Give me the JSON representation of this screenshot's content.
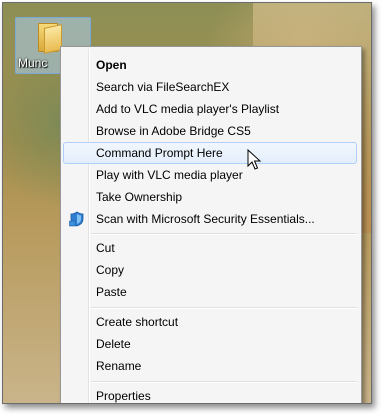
{
  "desktop": {
    "icon": {
      "name": "folder-icon",
      "label": "Munc"
    }
  },
  "menu": {
    "hovered_item": "Command Prompt Here",
    "groups": [
      [
        {
          "label": "Open",
          "bold": true
        },
        {
          "label": "Search via FileSearchEX"
        },
        {
          "label": "Add to VLC media player's Playlist"
        },
        {
          "label": "Browse in Adobe Bridge CS5"
        },
        {
          "label": "Command Prompt Here"
        },
        {
          "label": "Play with VLC media player"
        },
        {
          "label": "Take Ownership"
        },
        {
          "label": "Scan with Microsoft Security Essentials...",
          "icon": "microsoft-security-essentials-icon"
        }
      ],
      [
        {
          "label": "Cut"
        },
        {
          "label": "Copy"
        },
        {
          "label": "Paste"
        }
      ],
      [
        {
          "label": "Create shortcut"
        },
        {
          "label": "Delete"
        },
        {
          "label": "Rename"
        }
      ],
      [
        {
          "label": "Properties"
        }
      ]
    ]
  },
  "colors": {
    "menu_background": "#f5f5f5",
    "hover_border": "#aecff7",
    "selection_blue": "#aacdf1"
  }
}
